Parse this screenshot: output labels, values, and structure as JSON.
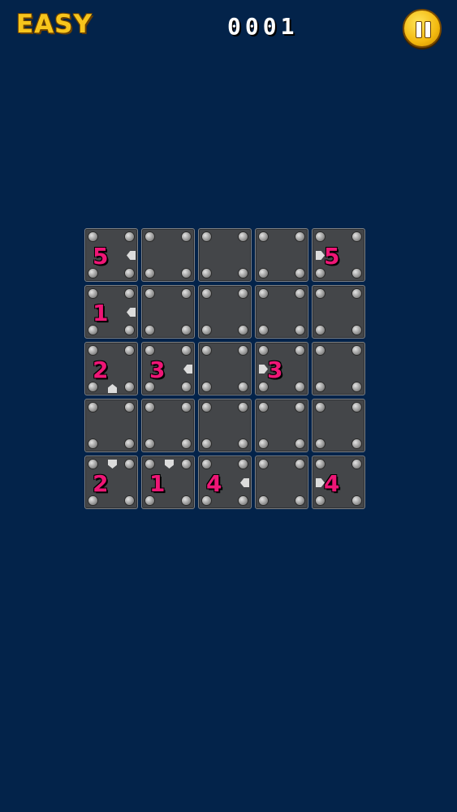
{
  "header": {
    "difficulty": "EASY",
    "score": "0001",
    "pause_icon": "pause-icon"
  },
  "colors": {
    "background": "#03234a",
    "tile": "#444649",
    "clue": "#ee1676",
    "difficulty": "#f7c51c",
    "pause_button": "#f3b90f"
  },
  "board": {
    "rows": 5,
    "cols": 5,
    "cells": [
      [
        {
          "clue": "5",
          "arrow": "left"
        },
        {},
        {},
        {},
        {
          "clue": "5",
          "arrow": "right"
        }
      ],
      [
        {
          "clue": "1",
          "arrow": "left"
        },
        {},
        {},
        {},
        {}
      ],
      [
        {
          "clue": "2",
          "arrow": "up"
        },
        {
          "clue": "3",
          "arrow": "left"
        },
        {},
        {
          "clue": "3",
          "arrow": "right"
        },
        {}
      ],
      [
        {},
        {},
        {},
        {},
        {}
      ],
      [
        {
          "clue": "2",
          "arrow": "down"
        },
        {
          "clue": "1",
          "arrow": "down"
        },
        {
          "clue": "4",
          "arrow": "left"
        },
        {},
        {
          "clue": "4",
          "arrow": "right"
        }
      ]
    ]
  }
}
